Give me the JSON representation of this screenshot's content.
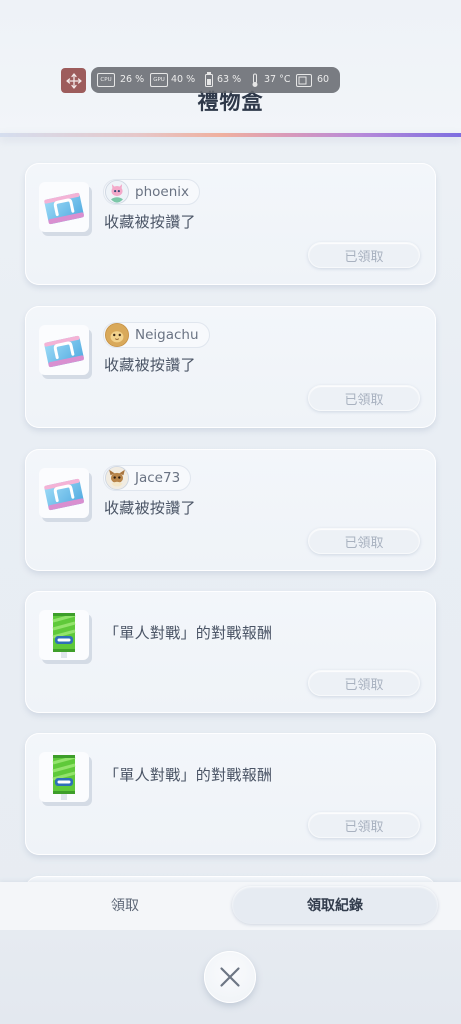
{
  "overlay": {
    "move_icon": "move-icon",
    "stats": {
      "cpu": {
        "icon": "cpu-icon",
        "icon_label": "CPU",
        "value": "26 %"
      },
      "gpu": {
        "icon": "gpu-icon",
        "icon_label": "GPU",
        "value": "40 %"
      },
      "battery": {
        "icon": "battery-icon",
        "value": "63 %"
      },
      "temperature": {
        "icon": "thermometer-icon",
        "value": "37 °C"
      },
      "fps": {
        "icon": "fps-icon",
        "value": "60"
      }
    }
  },
  "header": {
    "title": "禮物盒"
  },
  "gifts": [
    {
      "item_icon": "gift-box-icon",
      "sender": {
        "avatar": "pink-pokemon-avatar",
        "name": "phoenix"
      },
      "message": "收藏被按讚了",
      "button_label": "已領取",
      "claimed": true
    },
    {
      "item_icon": "gift-box-icon",
      "sender": {
        "avatar": "yellow-pokemon-avatar",
        "name": "Neigachu"
      },
      "message": "收藏被按讚了",
      "button_label": "已領取",
      "claimed": true
    },
    {
      "item_icon": "gift-box-icon",
      "sender": {
        "avatar": "brown-pokemon-avatar",
        "name": "Jace73"
      },
      "message": "收藏被按讚了",
      "button_label": "已領取",
      "claimed": true
    },
    {
      "item_icon": "booster-pack-icon",
      "message": "「單人對戰」的對戰報酬",
      "button_label": "已領取",
      "claimed": true
    },
    {
      "item_icon": "booster-pack-icon",
      "message": "「單人對戰」的對戰報酬",
      "button_label": "已領取",
      "claimed": true
    }
  ],
  "tabs": [
    {
      "label": "領取",
      "selected": false
    },
    {
      "label": "領取紀錄",
      "selected": true
    }
  ],
  "close_button": {
    "icon": "close-icon"
  },
  "colors": {
    "background": "#e9eef4",
    "card": "#f1f4f8",
    "title_text": "#2e3849",
    "body_text": "#4b5566",
    "muted_text": "#a9b2c0",
    "overlay_pill": "#686b71",
    "move_button": "#9d5c5c",
    "accent_gradient": [
      "#d5deef",
      "#efb09f",
      "#b78ad9",
      "#7d6ee0"
    ]
  }
}
